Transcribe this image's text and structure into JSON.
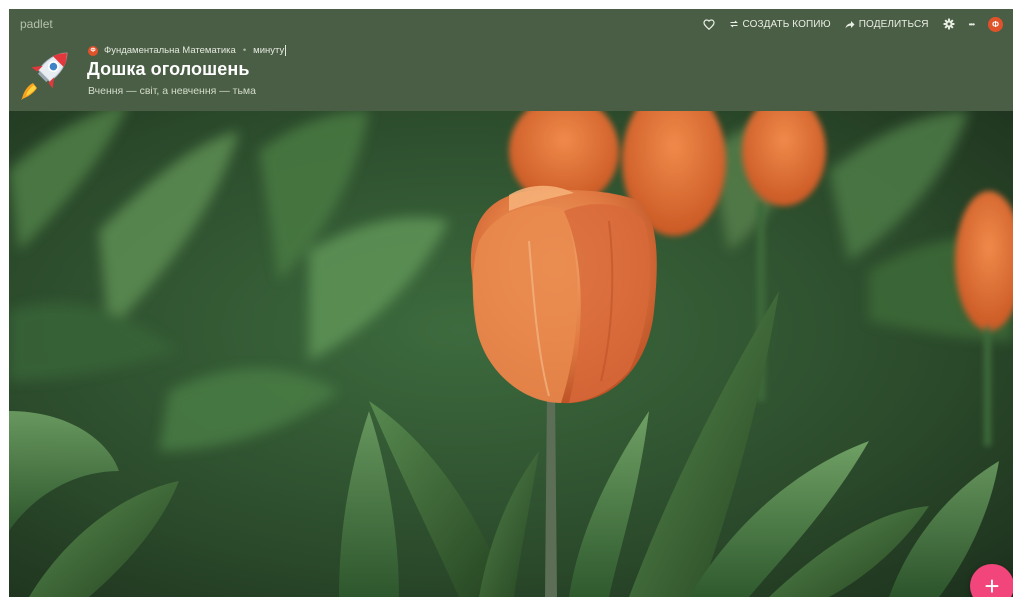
{
  "app": {
    "brand": "padlet"
  },
  "toolbar": {
    "like_icon": "heart-icon",
    "remake_icon": "remake-icon",
    "remake_label": "СОЗДАТЬ КОПИЮ",
    "share_icon": "share-arrow-icon",
    "share_label": "ПОДЕЛИТЬСЯ",
    "settings_icon": "gear-icon",
    "more_icon": "more-icon",
    "more_label": "•••",
    "avatar_initial": "Ф"
  },
  "board": {
    "icon": "rocket-icon",
    "author_initial": "Ф",
    "author": "Фундаментальна Математика",
    "separator": "•",
    "time": "минуту",
    "title": "Дошка оголошень",
    "subtitle": "Вчення — світ, а невчення — тьма",
    "wallpaper": "tulip-wallpaper"
  },
  "fab": {
    "label": "+"
  },
  "colors": {
    "header": "#4a5e45",
    "accent_pink": "#f2457b",
    "avatar_orange": "#e0522a"
  }
}
